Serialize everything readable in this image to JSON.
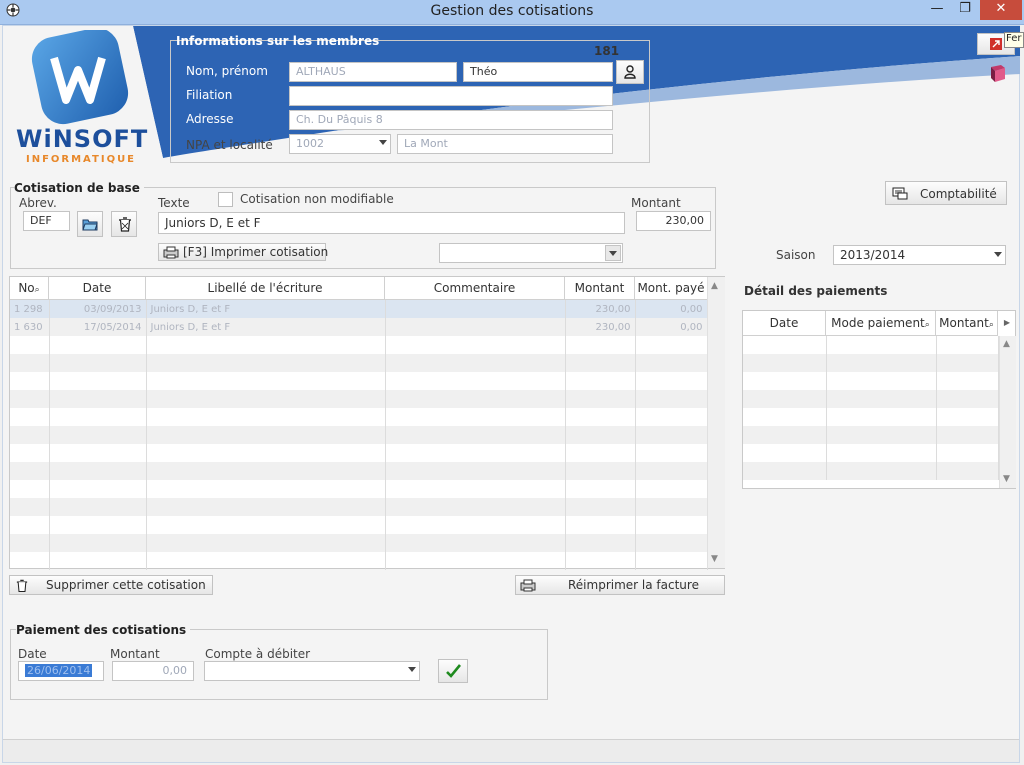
{
  "window": {
    "title": "Gestion des cotisations",
    "minimize": "—",
    "maximize": "❐",
    "close": "✕",
    "close_tooltip": "Fer"
  },
  "logo": {
    "brand": "WiNSOFT",
    "sub": "INFORMATIQUE",
    "monogram": "WI"
  },
  "member": {
    "group_title": "Informations sur les membres",
    "number": "181",
    "name_label": "Nom, prénom",
    "last_name": "ALTHAUS",
    "first_name": "Théo",
    "filiation_label": "Filiation",
    "filiation": "",
    "address_label": "Adresse",
    "address": "Ch. Du Pâquis 8",
    "locality_label": "NPA et localité",
    "npa": "1002",
    "locality": "La Mont"
  },
  "base": {
    "group_title": "Cotisation de base",
    "abrev_label": "Abrev.",
    "abrev": "DEF",
    "texte_label": "Texte",
    "non_modifiable_label": "Cotisation non modifiable",
    "texte": "Juniors   D, E et F",
    "montant_label": "Montant",
    "montant": "230,00",
    "print_label": "[F3] Imprimer cotisation",
    "combo": ""
  },
  "comptabilite_label": "Comptabilité",
  "saison": {
    "label": "Saison",
    "value": "2013/2014"
  },
  "grid": {
    "headers": [
      "No",
      "Date",
      "Libellé de l'écriture",
      "Commentaire",
      "Montant",
      "Mont. payé"
    ],
    "rows": [
      [
        "1 298",
        "03/09/2013",
        "Juniors   D, E et F",
        "",
        "230,00",
        "0,00"
      ],
      [
        "1 630",
        "17/05/2014",
        "Juniors   D, E et F",
        "",
        "230,00",
        "0,00"
      ]
    ]
  },
  "delete_label": "Supprimer cette cotisation",
  "reprint_label": "Réimprimer la facture",
  "detail": {
    "title": "Détail des paiements",
    "headers": [
      "Date",
      "Mode paiement",
      "Montant"
    ]
  },
  "payment": {
    "group_title": "Paiement des cotisations",
    "date_label": "Date",
    "date": "26/06/2014",
    "montant_label": "Montant",
    "montant": "0,00",
    "compte_label": "Compte à débiter",
    "compte": ""
  },
  "colors": {
    "titlebar": "#aac9f0",
    "banner": "#2d64b4",
    "accent": "#1a5fb4",
    "logo_orange": "#e8882a"
  }
}
